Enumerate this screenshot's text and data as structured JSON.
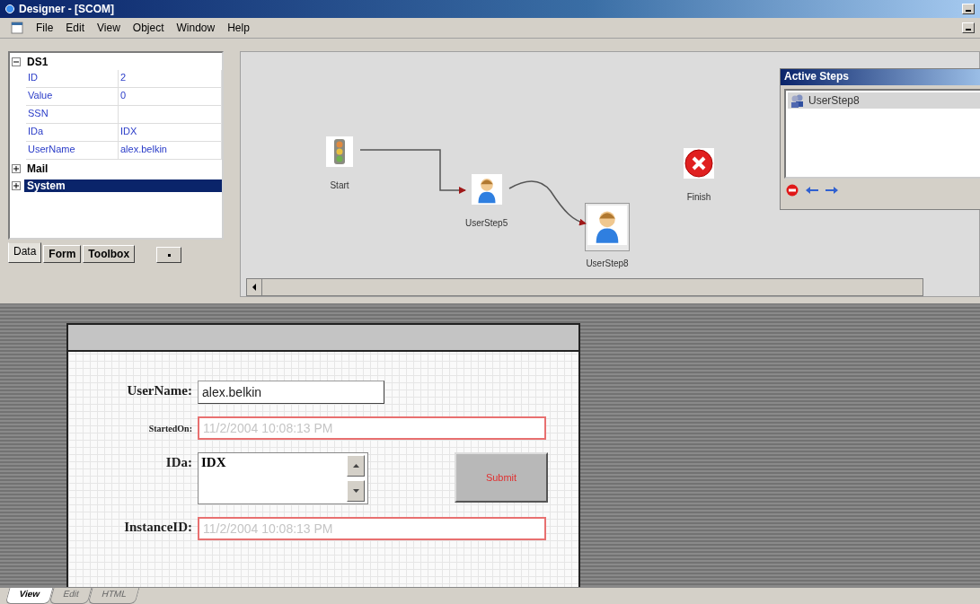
{
  "window": {
    "title": "Designer - [SCOM]"
  },
  "menu": [
    "File",
    "Edit",
    "View",
    "Object",
    "Window",
    "Help"
  ],
  "tree": [
    {
      "label": "DS1",
      "expanded": true,
      "selected": false,
      "children": [
        {
          "name": "ID",
          "value": "2"
        },
        {
          "name": "Value",
          "value": "0"
        },
        {
          "name": "SSN"
        },
        {
          "name": "IDa",
          "value": "IDX"
        },
        {
          "name": "UserName",
          "value": "alex.belkin"
        }
      ]
    },
    {
      "label": "Mail",
      "expanded": false,
      "selected": false
    },
    {
      "label": "System",
      "expanded": false,
      "selected": true
    }
  ],
  "panel_tabs": [
    {
      "label": "Data",
      "selected": true
    },
    {
      "label": "Form",
      "selected": false
    },
    {
      "label": "Toolbox",
      "selected": false
    }
  ],
  "diagram": {
    "nodes": [
      {
        "label": "Start",
        "kind": "start",
        "selected": false
      },
      {
        "label": "UserStep5",
        "kind": "user",
        "selected": false
      },
      {
        "label": "UserStep8",
        "kind": "user",
        "selected": true
      },
      {
        "label": "Finish",
        "kind": "finish",
        "selected": false
      }
    ]
  },
  "active_steps": {
    "title": "Active Steps",
    "items": [
      {
        "label": "UserStep8",
        "selected": true
      }
    ]
  },
  "form": {
    "fields": [
      {
        "label": "UserName:",
        "kind": "text",
        "value": "alex.belkin"
      },
      {
        "label": "StartedOn:",
        "kind": "text",
        "placeholder": "11/2/2004 10:08:13 PM"
      },
      {
        "label": "IDa:",
        "kind": "multiline",
        "value": "IDX"
      },
      {
        "label": "InstanceID:",
        "kind": "text",
        "placeholder": "11/2/2004 10:08:13 PM"
      }
    ],
    "submit": "Submit"
  },
  "view_tabs": [
    {
      "label": "View",
      "selected": true
    },
    {
      "label": "Edit",
      "selected": false
    },
    {
      "label": "HTML",
      "selected": false
    }
  ]
}
